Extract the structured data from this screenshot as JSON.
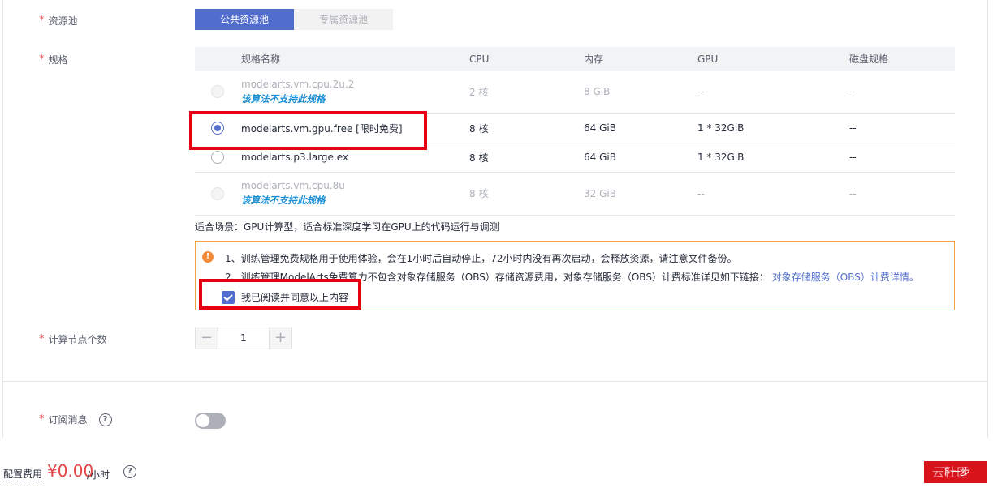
{
  "resource_pool": {
    "label": "资源池",
    "tabs": [
      "公共资源池",
      "专属资源池"
    ]
  },
  "spec": {
    "label": "规格",
    "columns": [
      "规格名称",
      "CPU",
      "内存",
      "GPU",
      "磁盘规格"
    ],
    "rows": [
      {
        "name": "modelarts.vm.cpu.2u.2",
        "note": "该算法不支持此规格",
        "cpu": "2 核",
        "mem": "8 GiB",
        "gpu": "--",
        "disk": "--",
        "state": "disabled"
      },
      {
        "name": "modelarts.vm.gpu.free [限时免费]",
        "note": "",
        "cpu": "8 核",
        "mem": "64 GiB",
        "gpu": "1 * 32GiB",
        "disk": "--",
        "state": "checked"
      },
      {
        "name": "modelarts.p3.large.ex",
        "note": "",
        "cpu": "8 核",
        "mem": "64 GiB",
        "gpu": "1 * 32GiB",
        "disk": "--",
        "state": "unchecked"
      },
      {
        "name": "modelarts.vm.cpu.8u",
        "note": "该算法不支持此规格",
        "cpu": "8 核",
        "mem": "32 GiB",
        "gpu": "--",
        "disk": "--",
        "state": "disabled"
      }
    ],
    "scene": "适合场景：GPU计算型，适合标准深度学习在GPU上的代码运行与调测"
  },
  "notice": {
    "icon": "exclamation-icon",
    "line1": "1、训练管理免费规格用于使用体验，会在1小时后自动停止，72小时内没有再次启动，会释放资源，请注意文件备份。",
    "line2": "2、训练管理ModelArts免费算力不包含对象存储服务（OBS）存储资源费用，对象存储服务（OBS）计费标准详见如下链接：",
    "link": "对象存储服务（OBS）计费详情。",
    "agree": "我已阅读并同意以上内容"
  },
  "nodes": {
    "label": "计算节点个数",
    "minus": "−",
    "value": "1",
    "plus": "+"
  },
  "subscribe": {
    "label": "订阅消息",
    "help": "?"
  },
  "footer": {
    "fee_label": "配置费用",
    "price": "¥0.00",
    "unit": "/小时",
    "help": "?",
    "next": "下一步",
    "watermark": "云社区"
  },
  "colors": {
    "accent": "#526ecc",
    "annotation": "#e60012",
    "warning": "#f0a244",
    "price": "#e54545"
  }
}
